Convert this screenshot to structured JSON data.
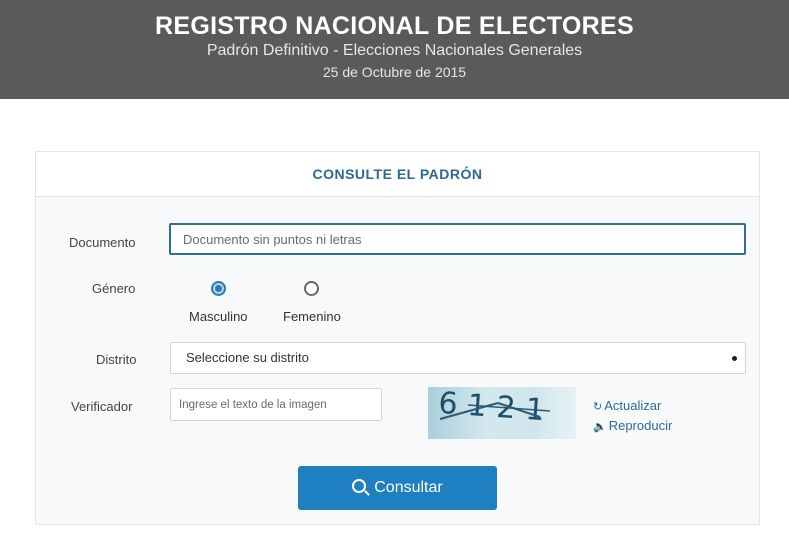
{
  "header": {
    "title": "REGISTRO NACIONAL DE ELECTORES",
    "subtitle": "Padrón Definitivo - Elecciones Nacionales Generales",
    "date": "25 de Octubre de 2015"
  },
  "form": {
    "heading": "CONSULTE EL PADRÓN",
    "documento": {
      "label": "Documento",
      "placeholder": "Documento sin puntos ni letras",
      "value": ""
    },
    "genero": {
      "label": "Género",
      "options": [
        {
          "label": "Masculino",
          "checked": true
        },
        {
          "label": "Femenino",
          "checked": false
        }
      ]
    },
    "distrito": {
      "label": "Distrito",
      "selected": "Seleccione su distrito"
    },
    "verificador": {
      "label": "Verificador",
      "placeholder": "Ingrese el texto de la imagen",
      "captcha_text": "6121",
      "refresh_label": "Actualizar",
      "audio_label": "Reproducir"
    },
    "submit_label": "Consultar"
  },
  "colors": {
    "header_bg": "#5a5a5a",
    "accent": "#1e7fc1",
    "heading_text": "#2c6a8e"
  }
}
